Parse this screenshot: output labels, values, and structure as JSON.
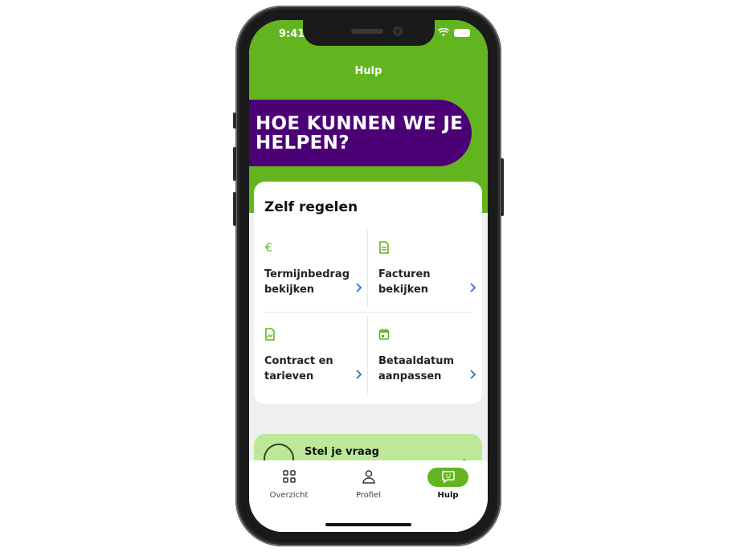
{
  "status": {
    "time": "9:41"
  },
  "header": {
    "title": "Hulp"
  },
  "hero": {
    "text": "HOE KUNNEN WE JE HELPEN?"
  },
  "self_service": {
    "title": "Zelf regelen",
    "items": [
      {
        "label": "Termijnbedrag bekijken",
        "icon": "euro-icon"
      },
      {
        "label": "Facturen bekijken",
        "icon": "document-icon"
      },
      {
        "label": "Contract en tarieven",
        "icon": "contract-icon"
      },
      {
        "label": "Betaaldatum aanpassen",
        "icon": "calendar-icon"
      }
    ]
  },
  "ask": {
    "label": "Stel je vraag"
  },
  "tabs": [
    {
      "label": "Overzicht",
      "icon": "grid-icon"
    },
    {
      "label": "Profiel",
      "icon": "person-icon"
    },
    {
      "label": "Hulp",
      "icon": "chat-icon",
      "active": true
    }
  ],
  "colors": {
    "brand_green": "#63b520",
    "brand_purple": "#4b0076",
    "chevron_blue": "#2f6fd6",
    "light_green": "#bde89a"
  }
}
